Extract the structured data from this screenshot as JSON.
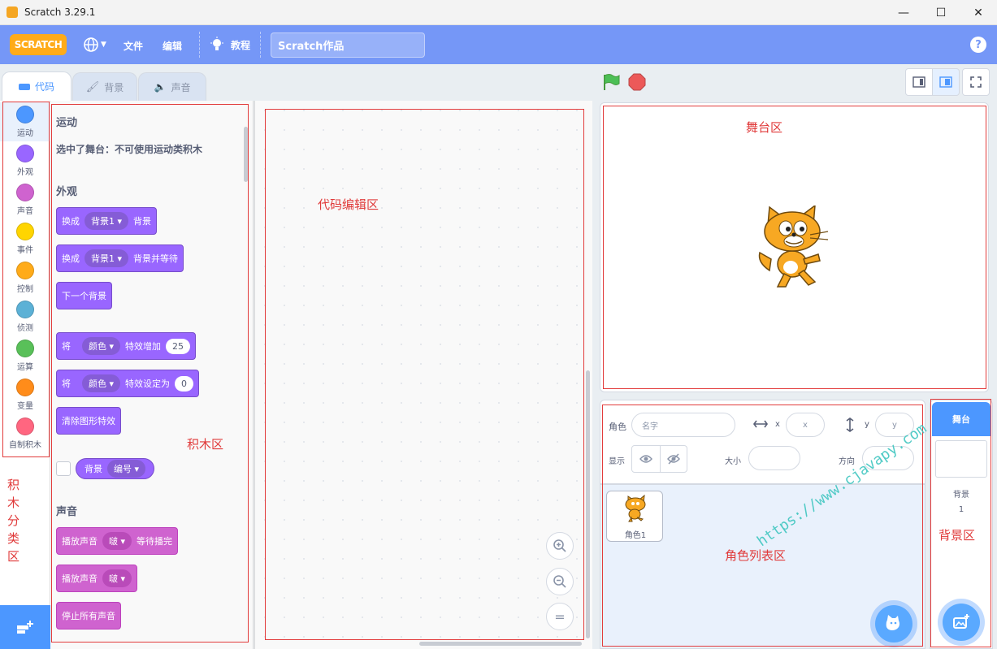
{
  "window": {
    "title": "Scratch 3.29.1",
    "minimize": "—",
    "maximize": "☐",
    "close": "✕"
  },
  "menubar": {
    "logo": "SCRATCH",
    "file": "文件",
    "edit": "编辑",
    "tutorials": "教程",
    "project_title": "Scratch作品",
    "help": "?"
  },
  "tabs": [
    {
      "label": "代码"
    },
    {
      "label": "背景"
    },
    {
      "label": "声音"
    }
  ],
  "categories": [
    {
      "label": "运动",
      "color": "#4c97ff"
    },
    {
      "label": "外观",
      "color": "#9966ff"
    },
    {
      "label": "声音",
      "color": "#cf63cf"
    },
    {
      "label": "事件",
      "color": "#ffd500"
    },
    {
      "label": "控制",
      "color": "#ffab19"
    },
    {
      "label": "侦测",
      "color": "#5cb1d6"
    },
    {
      "label": "运算",
      "color": "#59c059"
    },
    {
      "label": "变量",
      "color": "#ff8c1a"
    },
    {
      "label": "自制积木",
      "color": "#ff6680"
    }
  ],
  "palette": {
    "motion_title": "运动",
    "motion_note": "选中了舞台：不可使用运动类积木",
    "looks_title": "外观",
    "looks_blocks": [
      {
        "pre": "换成",
        "dropdown": "背景1",
        "post": "背景"
      },
      {
        "pre": "换成",
        "dropdown": "背景1",
        "post": "背景并等待"
      },
      {
        "pre": "下一个背景"
      },
      {
        "pre": "将",
        "dropdown": "颜色",
        "post": "特效增加",
        "value": "25"
      },
      {
        "pre": "将",
        "dropdown": "颜色",
        "post": "特效设定为",
        "value": "0"
      },
      {
        "pre": "清除图形特效"
      }
    ],
    "reporter": {
      "label": "背景",
      "dropdown": "编号"
    },
    "sound_title": "声音",
    "sound_blocks": [
      {
        "pre": "播放声音",
        "dropdown": "啵",
        "post": "等待播完"
      },
      {
        "pre": "播放声音",
        "dropdown": "啵"
      },
      {
        "pre": "停止所有声音"
      }
    ]
  },
  "zoom": {
    "in": "+",
    "out": "−",
    "reset": "="
  },
  "sprite_info": {
    "sprite_label": "角色",
    "name_placeholder": "名字",
    "x_label": "x",
    "x_placeholder": "x",
    "y_label": "y",
    "y_placeholder": "y",
    "show_label": "显示",
    "size_label": "大小",
    "direction_label": "方向"
  },
  "sprites": [
    {
      "name": "角色1"
    }
  ],
  "stage_pane": {
    "header": "舞台",
    "backdrop_label": "背景",
    "backdrop_count": "1"
  },
  "annotations": {
    "stage": "舞台区",
    "code": "代码编辑区",
    "blocks": "积木区",
    "categories": [
      "积",
      "木",
      "分",
      "类",
      "区"
    ],
    "sprites": "角色列表区",
    "backdrop": "背景区"
  },
  "watermark": "https://www.cjavapy.com"
}
